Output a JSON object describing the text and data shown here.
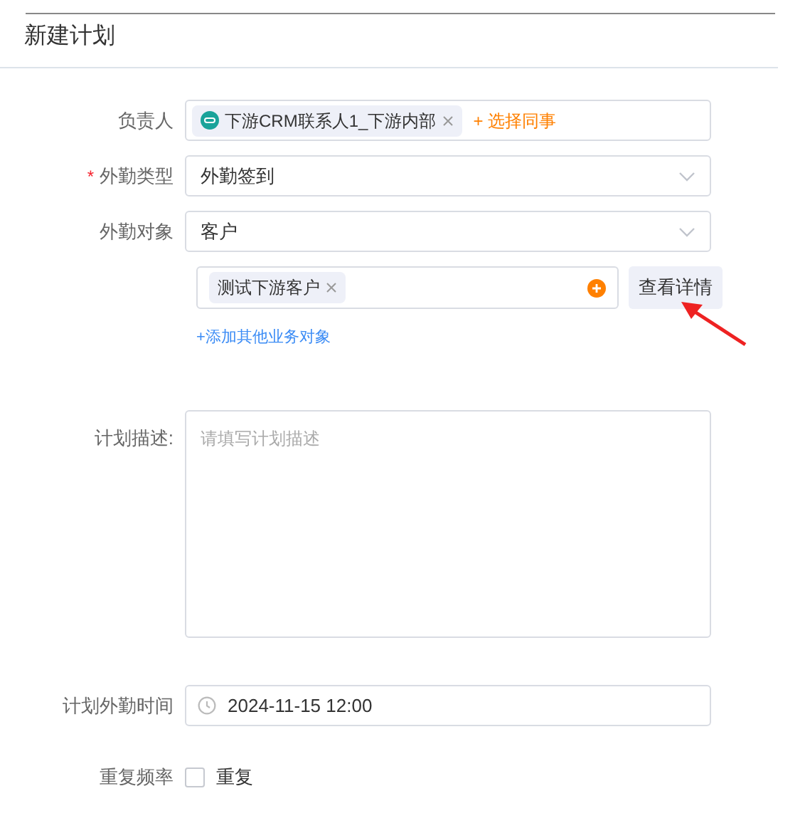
{
  "title": "新建计划",
  "fields": [
    {
      "kind": "people",
      "label": "负责人",
      "tags": [
        "下游CRM联系人1_下游内部"
      ],
      "action": "+ 选择同事"
    },
    {
      "kind": "select",
      "label": "外勤类型",
      "required_mark": "*",
      "value": "外勤签到"
    },
    {
      "kind": "select",
      "label": "外勤对象",
      "value": "客户"
    },
    {
      "kind": "objects",
      "tags": [
        "测试下游客户"
      ],
      "button": "查看详情",
      "link": "+添加其他业务对象"
    },
    {
      "kind": "textarea",
      "label": "计划描述:",
      "placeholder": "请填写计划描述"
    },
    {
      "kind": "datetime",
      "label": "计划外勤时间",
      "value": "2024-11-15 12:00"
    },
    {
      "kind": "checkbox",
      "label": "重复频率",
      "option": "重复",
      "checked": false
    }
  ]
}
